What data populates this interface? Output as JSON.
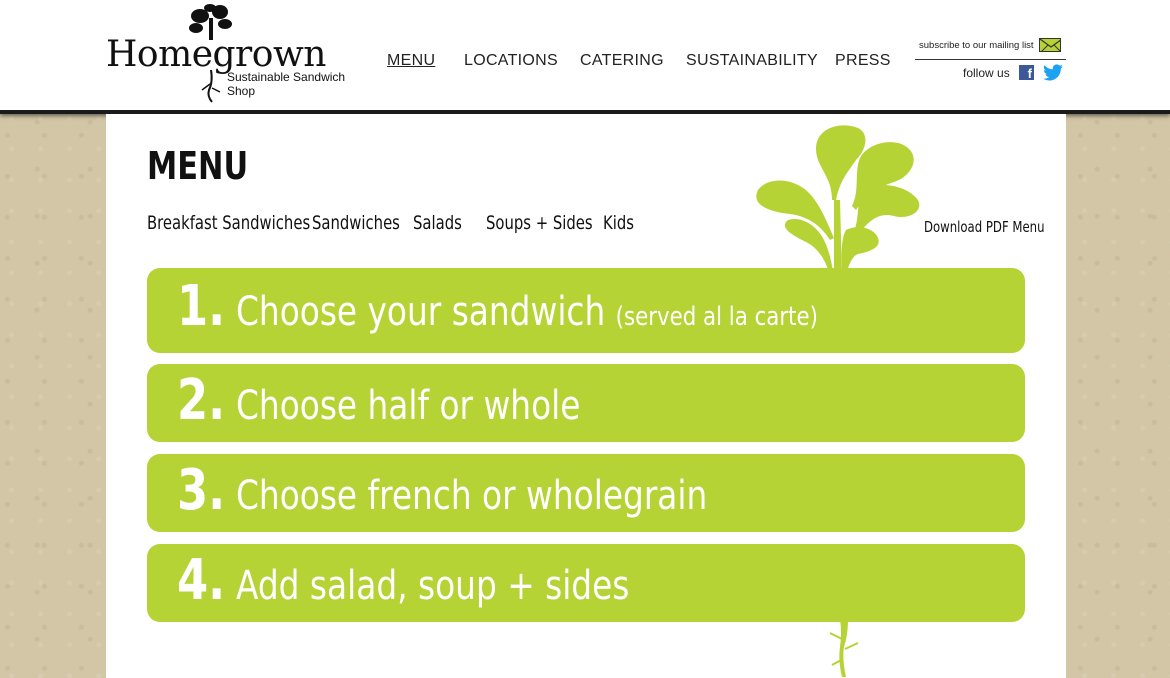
{
  "brand": {
    "name": "Homegrown",
    "tagline": "Sustainable Sandwich Shop"
  },
  "nav": {
    "items": [
      {
        "label": "MENU",
        "active": true
      },
      {
        "label": "LOCATIONS",
        "active": false
      },
      {
        "label": "CATERING",
        "active": false
      },
      {
        "label": "SUSTAINABILITY",
        "active": false
      },
      {
        "label": "PRESS",
        "active": false
      }
    ]
  },
  "utility": {
    "subscribe_label": "subscribe to our mailing list",
    "follow_label": "follow us",
    "icons": [
      "mail-icon",
      "facebook-icon",
      "twitter-icon"
    ]
  },
  "page": {
    "title": "MENU",
    "subnav": [
      "Breakfast Sandwiches",
      "Sandwiches",
      "Salads",
      "Soups + Sides",
      "Kids"
    ],
    "pdf_link": "Download PDF Menu"
  },
  "steps": [
    {
      "number": "1.",
      "text": "Choose your sandwich",
      "note": "(served al la carte)"
    },
    {
      "number": "2.",
      "text": "Choose half or whole",
      "note": ""
    },
    {
      "number": "3.",
      "text": "Choose french or wholegrain",
      "note": ""
    },
    {
      "number": "4.",
      "text": "Add salad, soup + sides",
      "note": ""
    }
  ],
  "colors": {
    "accent_green": "#b5d335",
    "text_dark": "#111111",
    "background_kraft": "#d2c6a6",
    "facebook_blue": "#3b5998",
    "twitter_blue": "#1da1f2"
  }
}
